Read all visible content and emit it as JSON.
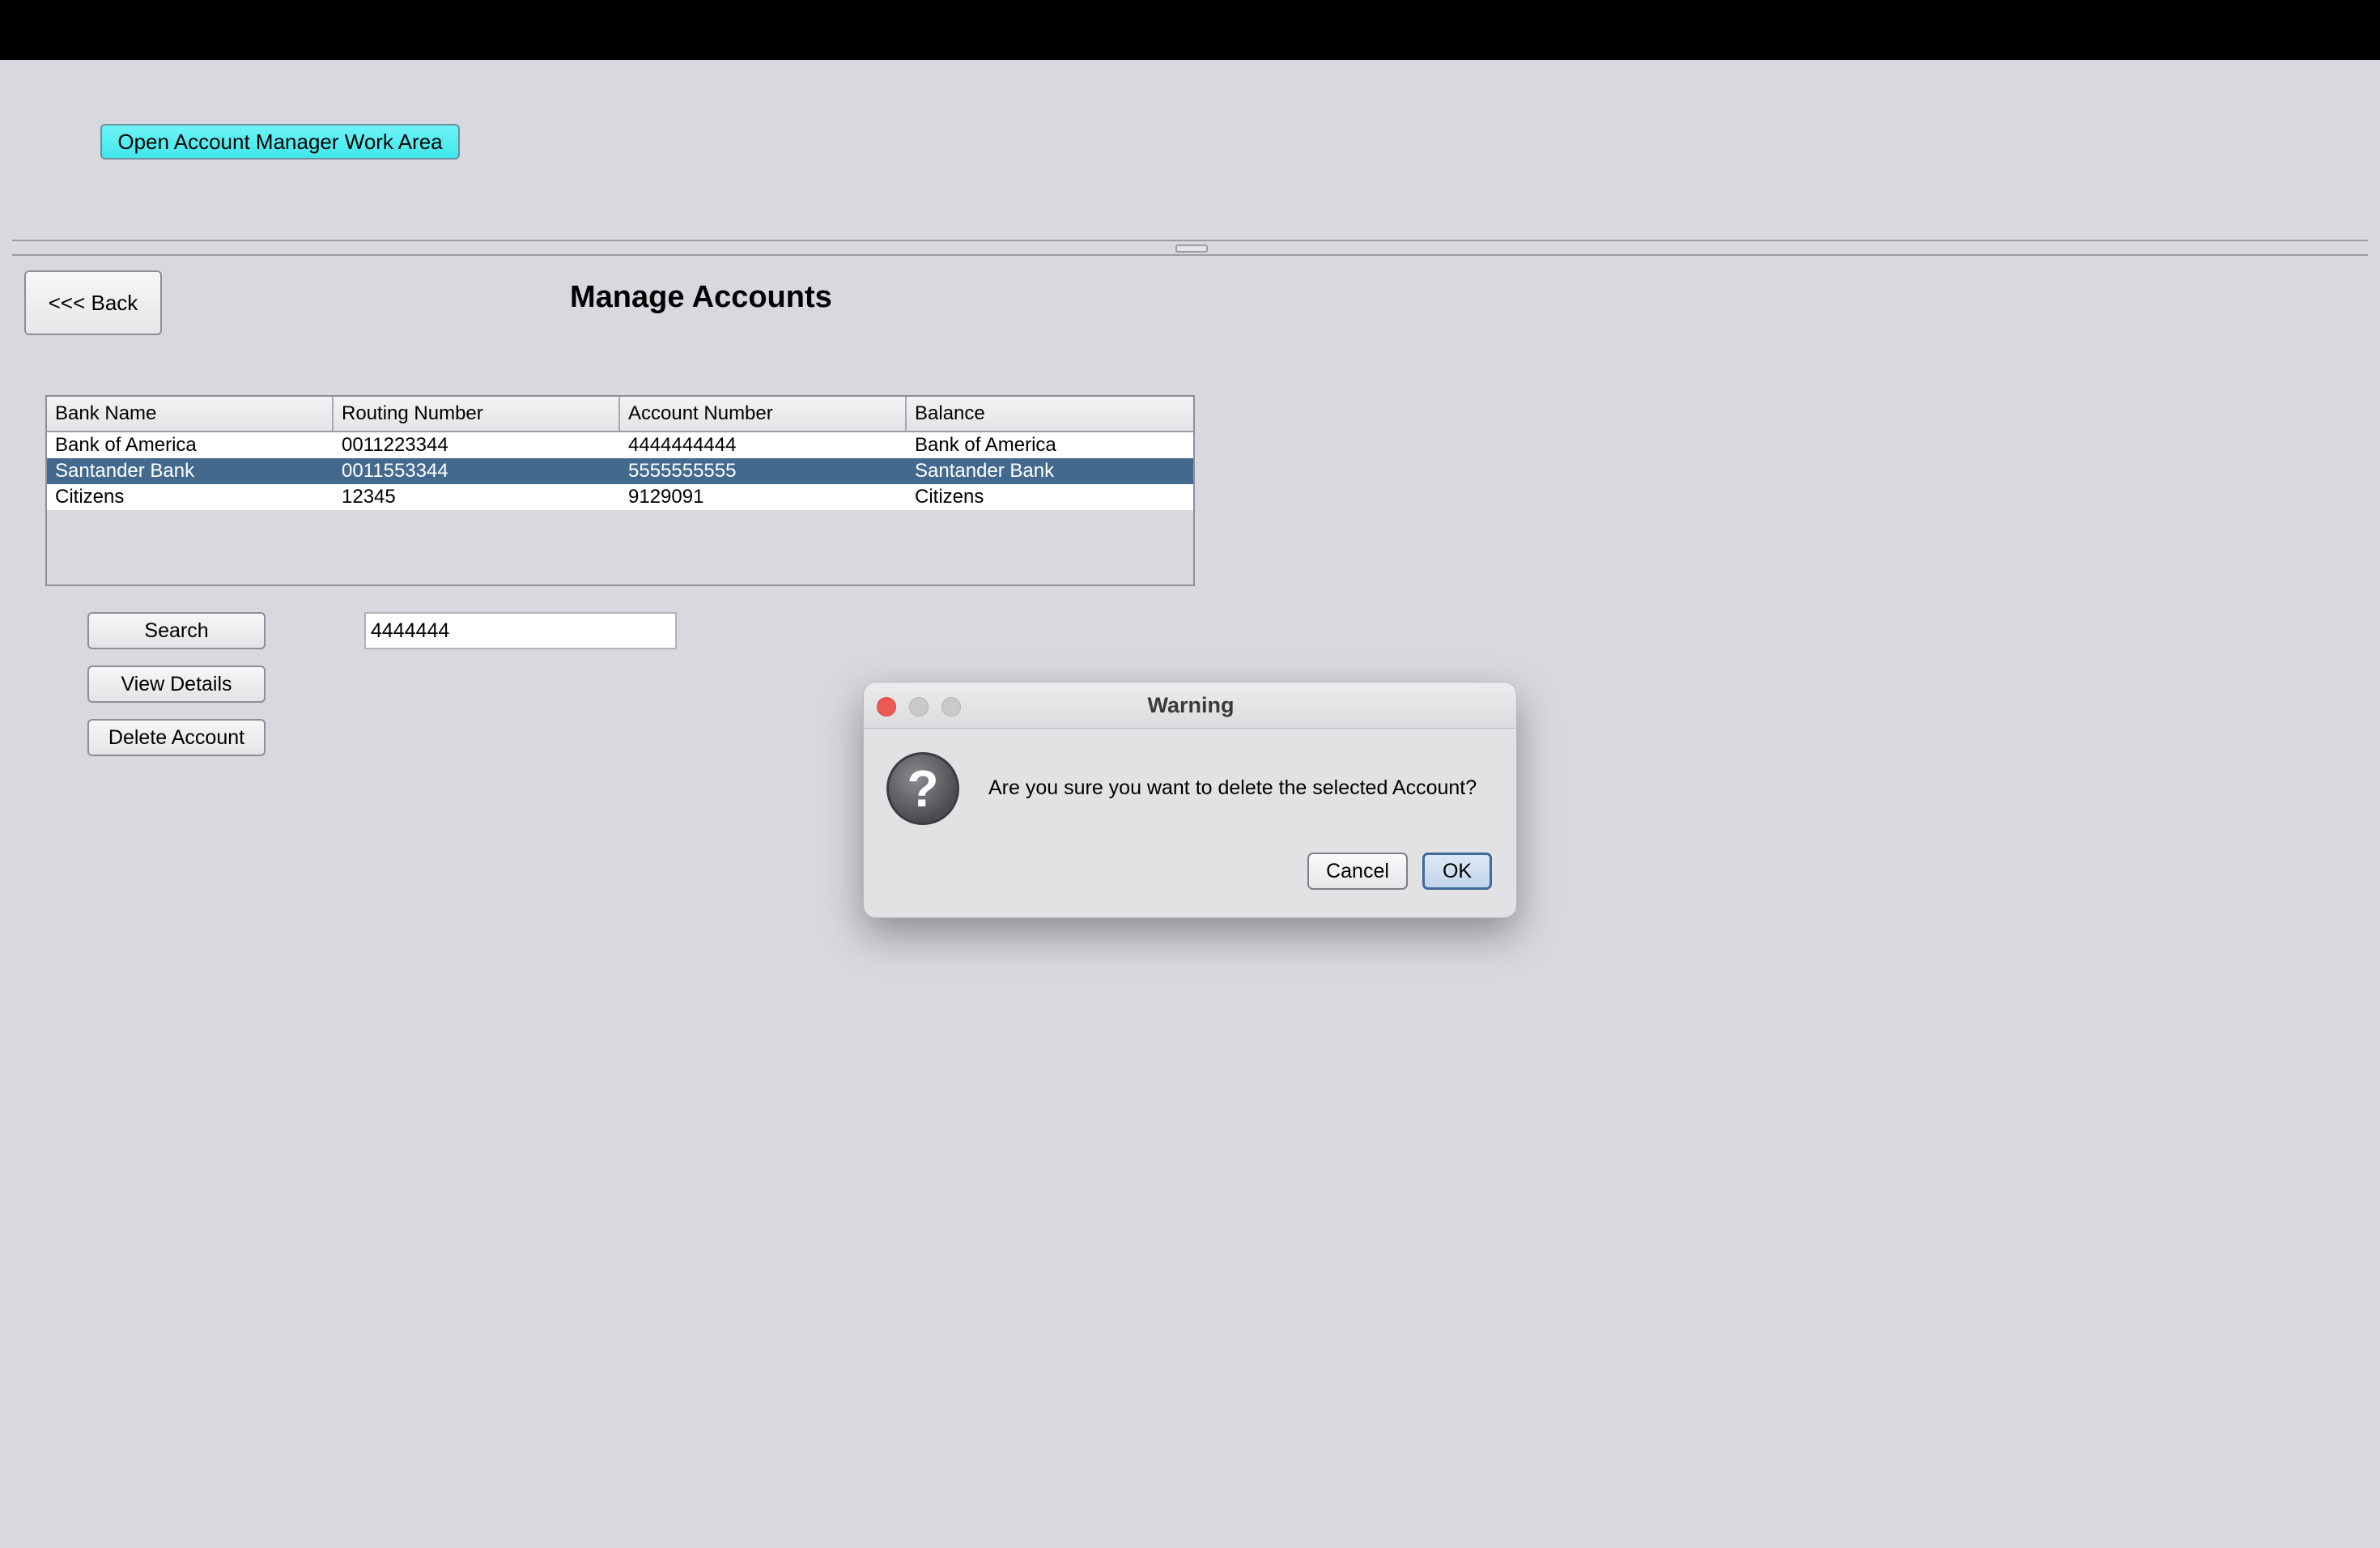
{
  "header": {
    "open_work_area_label": "Open Account Manager Work Area"
  },
  "page": {
    "back_label": "<<< Back",
    "title": "Manage Accounts"
  },
  "table": {
    "columns": [
      "Bank Name",
      "Routing Number",
      "Account Number",
      "Balance"
    ],
    "rows": [
      [
        "Bank of America",
        "0011223344",
        "4444444444",
        "Bank of America"
      ],
      [
        "Santander Bank",
        "0011553344",
        "5555555555",
        "Santander Bank"
      ],
      [
        "Citizens",
        "12345",
        "9129091",
        "Citizens"
      ]
    ],
    "selected_row": 1
  },
  "actions": {
    "search_label": "Search",
    "view_details_label": "View Details",
    "delete_label": "Delete Account"
  },
  "search": {
    "value": "4444444"
  },
  "dialog": {
    "title": "Warning",
    "message": "Are you sure you want to delete the selected Account?",
    "icon": "question-icon",
    "cancel_label": "Cancel",
    "ok_label": "OK"
  },
  "colors": {
    "accent_button": "#4FEDF0",
    "selection": "#436A8E",
    "background": "#D8D9DE"
  }
}
